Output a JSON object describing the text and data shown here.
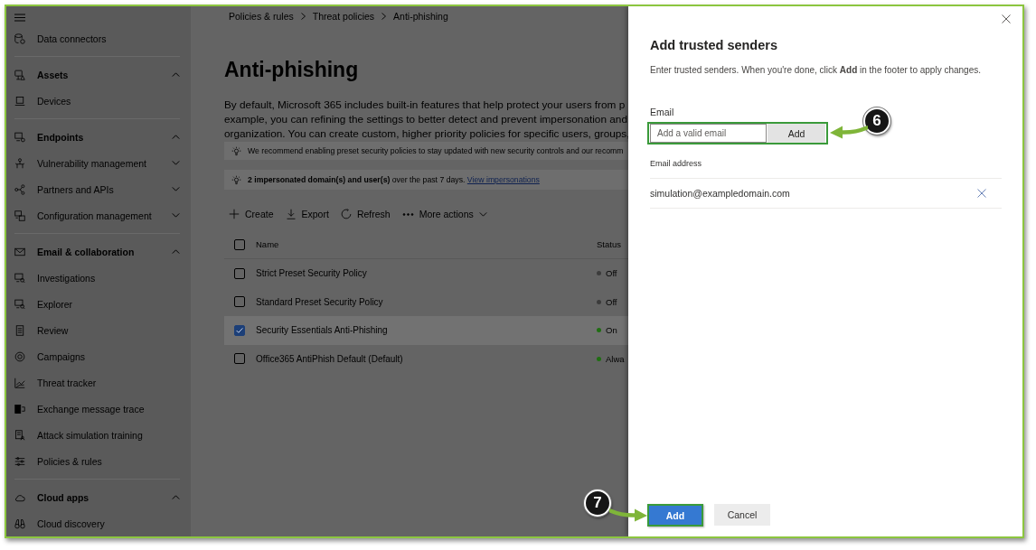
{
  "sidebar": {
    "items": [
      {
        "kind": "link",
        "label": "Data connectors"
      },
      {
        "kind": "section",
        "label": "Assets",
        "expanded": true,
        "children": [
          {
            "kind": "link",
            "label": "Devices"
          }
        ]
      },
      {
        "kind": "section",
        "label": "Endpoints",
        "expanded": true,
        "children": [
          {
            "kind": "link",
            "label": "Vulnerability management",
            "expanded": false
          },
          {
            "kind": "link",
            "label": "Partners and APIs",
            "expanded": false
          },
          {
            "kind": "link",
            "label": "Configuration management",
            "expanded": false
          }
        ]
      },
      {
        "kind": "section",
        "label": "Email & collaboration",
        "expanded": true,
        "children": [
          {
            "kind": "link",
            "label": "Investigations"
          },
          {
            "kind": "link",
            "label": "Explorer"
          },
          {
            "kind": "link",
            "label": "Review"
          },
          {
            "kind": "link",
            "label": "Campaigns"
          },
          {
            "kind": "link",
            "label": "Threat tracker"
          },
          {
            "kind": "link",
            "label": "Exchange message trace"
          },
          {
            "kind": "link",
            "label": "Attack simulation training"
          },
          {
            "kind": "link",
            "label": "Policies & rules"
          }
        ]
      },
      {
        "kind": "section",
        "label": "Cloud apps",
        "expanded": true,
        "children": [
          {
            "kind": "link",
            "label": "Cloud discovery"
          }
        ]
      }
    ]
  },
  "breadcrumb": [
    {
      "label": "Policies & rules"
    },
    {
      "label": "Threat policies"
    },
    {
      "label": "Anti-phishing"
    }
  ],
  "page": {
    "title": "Anti-phishing",
    "description_lines": [
      "By default, Microsoft 365 includes built-in features that help protect your users from p",
      "example, you can refining the settings to better detect and prevent impersonation and",
      "organization. You can create custom, higher priority policies for specific users, groups,"
    ],
    "notices": [
      {
        "text": "We recommend enabling preset security policies to stay updated with new security controls and our recomm"
      },
      {
        "text": "**2 impersonated domain(s) and user(s)** over the past 7 days.",
        "link": "View impersonations"
      }
    ]
  },
  "toolbar": [
    {
      "label": "Create",
      "kind": "action"
    },
    {
      "label": "Export",
      "kind": "action"
    },
    {
      "label": "Refresh",
      "kind": "action"
    },
    {
      "label": "More actions",
      "kind": "menu"
    }
  ],
  "table": {
    "select_all": {
      "checked": false
    },
    "columns": [
      {
        "label": "Name"
      },
      {
        "label": "Status"
      }
    ],
    "rows": [
      {
        "name": "Strict Preset Security Policy",
        "status": "Off",
        "color": "#3c3c3c",
        "selected": false
      },
      {
        "name": "Standard Preset Security Policy",
        "status": "Off",
        "color": "#3c3c3c",
        "selected": false
      },
      {
        "name": "Security Essentials Anti-Phishing",
        "status": "On",
        "color": "#1f6e12",
        "selected": true
      },
      {
        "name": "Office365 AntiPhish Default (Default)",
        "status": "Alwa",
        "color": "#1f6e12",
        "selected": false
      }
    ]
  },
  "panel": {
    "title": "Add trusted senders",
    "description": "Enter trusted senders. When you're done, click **Add** in the footer to apply changes.",
    "email_field": {
      "label": "Email",
      "placeholder": "Add a valid email",
      "button": "Add",
      "highlighted": true
    },
    "list": {
      "column": "Email address",
      "entries": [
        {
          "address": "simulation@exampledomain.com"
        }
      ]
    },
    "footer": [
      {
        "label": "Add",
        "kind": "primary",
        "highlighted": true
      },
      {
        "label": "Cancel",
        "kind": "secondary",
        "highlighted": false
      }
    ]
  },
  "callouts": [
    {
      "number": "6"
    },
    {
      "number": "7"
    }
  ]
}
